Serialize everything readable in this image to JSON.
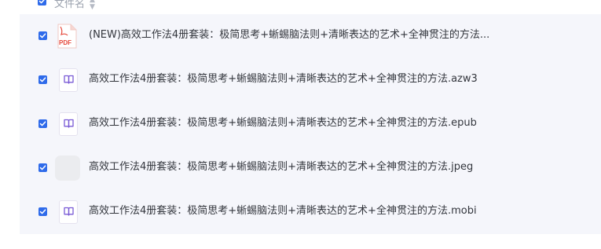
{
  "header": {
    "column_title": "文件名",
    "sort_icon": "sort-icon",
    "select_all_checked": true
  },
  "files": [
    {
      "name": "(NEW)高效工作法4册套装：极简思考+蜥蜴脑法则+清晰表达的艺术+全神贯注的方法...",
      "icon": "pdf-icon",
      "checked": true
    },
    {
      "name": "高效工作法4册套装：极简思考+蜥蜴脑法则+清晰表达的艺术+全神贯注的方法.azw3",
      "icon": "ebook-icon",
      "checked": true
    },
    {
      "name": "高效工作法4册套装：极简思考+蜥蜴脑法则+清晰表达的艺术+全神贯注的方法.epub",
      "icon": "ebook-icon",
      "checked": true
    },
    {
      "name": "高效工作法4册套装：极简思考+蜥蜴脑法则+清晰表达的艺术+全神贯注的方法.jpeg",
      "icon": "image-placeholder-icon",
      "checked": true
    },
    {
      "name": "高效工作法4册套装：极简思考+蜥蜴脑法则+清晰表达的艺术+全神贯注的方法.mobi",
      "icon": "ebook-icon",
      "checked": true
    }
  ],
  "pdf_icon_label": "PDF",
  "colors": {
    "accent": "#2f6bea",
    "list_background": "#f5f6fb",
    "pdf_red": "#e5483b",
    "ebook_purple": "#7a5bd6"
  }
}
